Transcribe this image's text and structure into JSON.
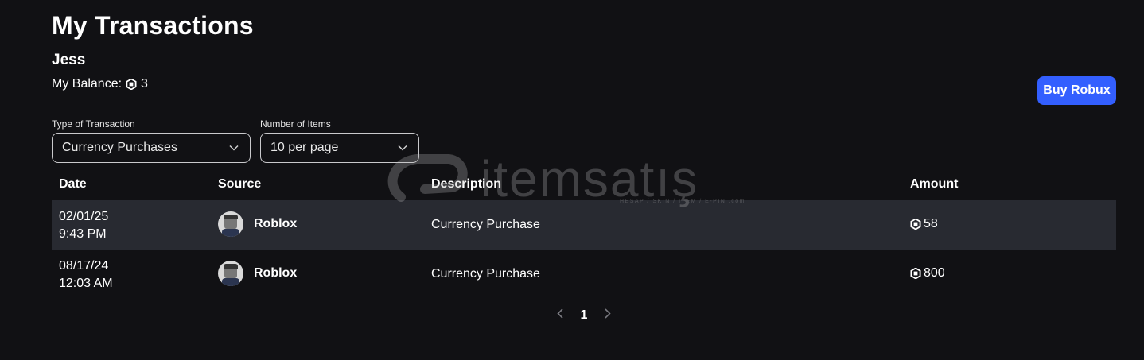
{
  "header": {
    "title": "My Transactions",
    "username": "Jess",
    "balance_label": "My Balance:",
    "balance_value": "3",
    "buy_button": "Buy Robux"
  },
  "filters": {
    "type": {
      "label": "Type of Transaction",
      "value": "Currency Purchases"
    },
    "items": {
      "label": "Number of Items",
      "value": "10 per page"
    }
  },
  "table": {
    "headers": {
      "date": "Date",
      "source": "Source",
      "description": "Description",
      "amount": "Amount"
    },
    "rows": [
      {
        "date": "02/01/25",
        "time": "9:43 PM",
        "source": "Roblox",
        "description": "Currency Purchase",
        "amount": "58"
      },
      {
        "date": "08/17/24",
        "time": "12:03 AM",
        "source": "Roblox",
        "description": "Currency Purchase",
        "amount": "800"
      }
    ]
  },
  "pagination": {
    "current_page": "1"
  },
  "watermark": {
    "text": "itemsatış",
    "sub": "HESAP / SKIN / ITEM / E-PIN .com"
  },
  "colors": {
    "background": "#111114",
    "accent": "#335fff",
    "row_highlight": "#282a31"
  },
  "icons": [
    "robux-icon",
    "chevron-down-icon",
    "chevron-left-icon",
    "chevron-right-icon",
    "avatar"
  ]
}
